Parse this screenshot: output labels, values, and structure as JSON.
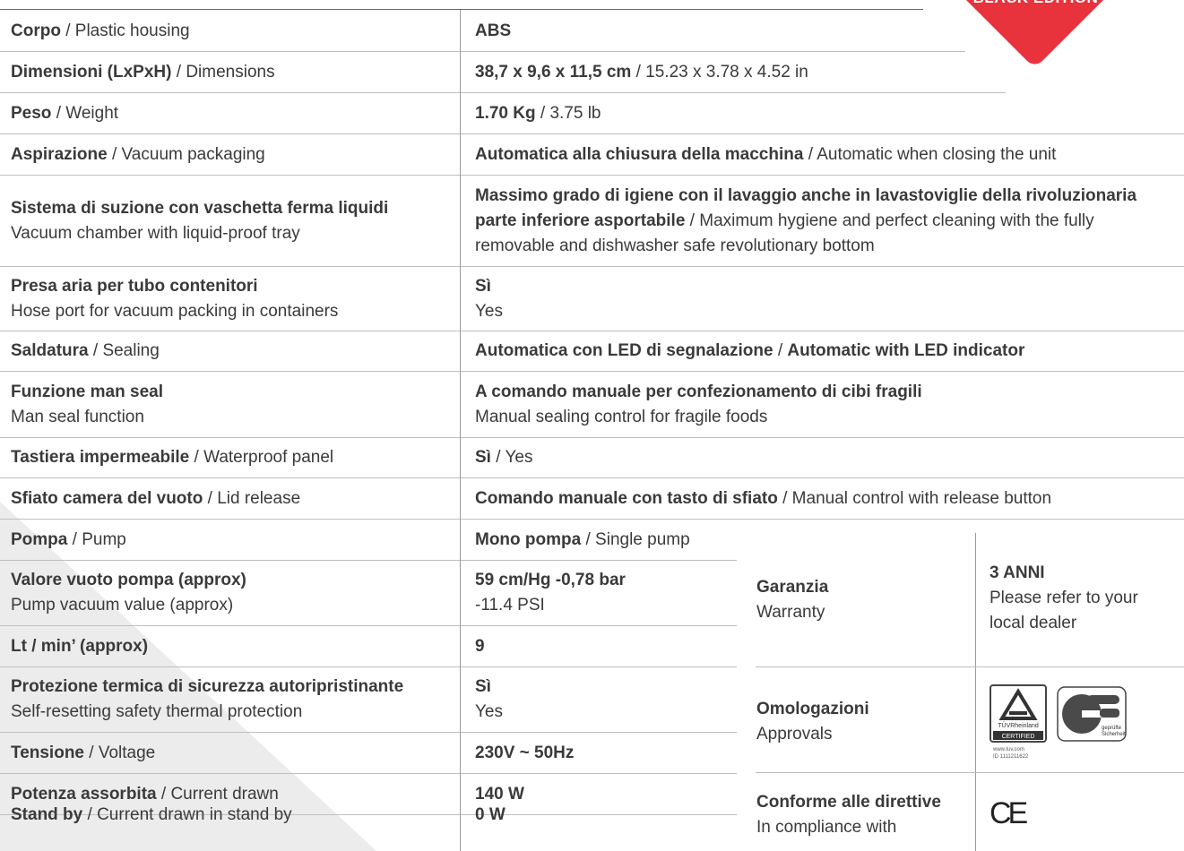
{
  "badge": {
    "text": "BLACK EDITION",
    "color": "#e8323c"
  },
  "rows": [
    {
      "label_it": "Corpo",
      "label_en": "Plastic housing",
      "value_it": "ABS",
      "value_en": ""
    },
    {
      "label_it": "Dimensioni (LxPxH)",
      "label_en": "Dimensions",
      "value_it": "38,7 x 9,6 x 11,5 cm",
      "value_en": "15.23 x 3.78 x 4.52 in"
    },
    {
      "label_it": "Peso",
      "label_en": "Weight",
      "value_it": "1.70 Kg",
      "value_en": "3.75 lb"
    },
    {
      "label_it": "Aspirazione",
      "label_en": "Vacuum packaging",
      "value_it": "Automatica alla chiusura della macchina",
      "value_en": "Automatic when closing the unit"
    },
    {
      "label_it": "Sistema di suzione con vaschetta ferma liquidi",
      "label_en": "Vacuum chamber with liquid-proof tray",
      "value_it": "Massimo grado di igiene con il lavaggio anche in lavastoviglie della rivoluzionaria parte inferiore asportabile",
      "value_en": "Maximum hygiene and perfect cleaning with the fully removable and dishwasher safe revolutionary bottom"
    },
    {
      "label_it": "Presa aria per tubo contenitori",
      "label_en": "Hose port for vacuum packing in containers",
      "value_it": "Sì",
      "value_en": "Yes"
    },
    {
      "label_it": "Saldatura",
      "label_en": "Sealing",
      "value_it": "Automatica con LED di segnalazione",
      "value_en": "Automatic with LED indicator"
    },
    {
      "label_it": "Funzione man seal",
      "label_en": "Man seal function",
      "value_it": "A comando manuale per confezionamento di cibi fragili",
      "value_en": "Manual sealing control for fragile foods"
    },
    {
      "label_it": "Tastiera impermeabile",
      "label_en": "Waterproof panel",
      "value_it": "Sì",
      "value_en": "Yes"
    },
    {
      "label_it": "Sfiato camera del vuoto",
      "label_en": "Lid release",
      "value_it": "Comando manuale con tasto di sfiato",
      "value_en": "Manual control with release button"
    },
    {
      "label_it": "Pompa",
      "label_en": "Pump",
      "value_it": "Mono pompa",
      "value_en": "Single pump"
    },
    {
      "label_it": "Valore vuoto pompa (approx)",
      "label_en": "Pump vacuum value (approx)",
      "value_it": "59 cm/Hg -0,78 bar",
      "value_en": "-11.4 PSI"
    },
    {
      "label_it": "Lt / min’ (approx)",
      "label_en": "",
      "value_it": "9",
      "value_en": ""
    },
    {
      "label_it": "Protezione termica di sicurezza autoripristinante",
      "label_en": "Self-resetting safety thermal protection",
      "value_it": "Sì",
      "value_en": "Yes"
    },
    {
      "label_it": "Tensione",
      "label_en": "Voltage",
      "value_it": "230V ~ 50Hz",
      "value_en": ""
    },
    {
      "label_it": "Potenza assorbita",
      "label_en": "Current drawn",
      "value_it": "140 W",
      "value_en": ""
    },
    {
      "label_it": "Stand by",
      "label_en": "Current drawn in stand by",
      "value_it": "0 W",
      "value_en": ""
    }
  ],
  "right": {
    "warranty": {
      "label_it": "Garanzia",
      "label_en": "Warranty",
      "value_bold": "3 ANNI",
      "value_text": "Please refer to your local dealer"
    },
    "approvals": {
      "label_it": "Omologazioni",
      "label_en": "Approvals",
      "tuv_brand": "TÜVRheinland",
      "tuv_certified": "CERTIFIED",
      "tuv_url": "www.tuv.com",
      "tuv_id": "ID 1111211622",
      "gs_text1": "geprüfte",
      "gs_text2": "Sicherheit"
    },
    "compliance": {
      "label_it": "Conforme alle direttive",
      "label_en": "In compliance with",
      "mark": "CE"
    }
  }
}
